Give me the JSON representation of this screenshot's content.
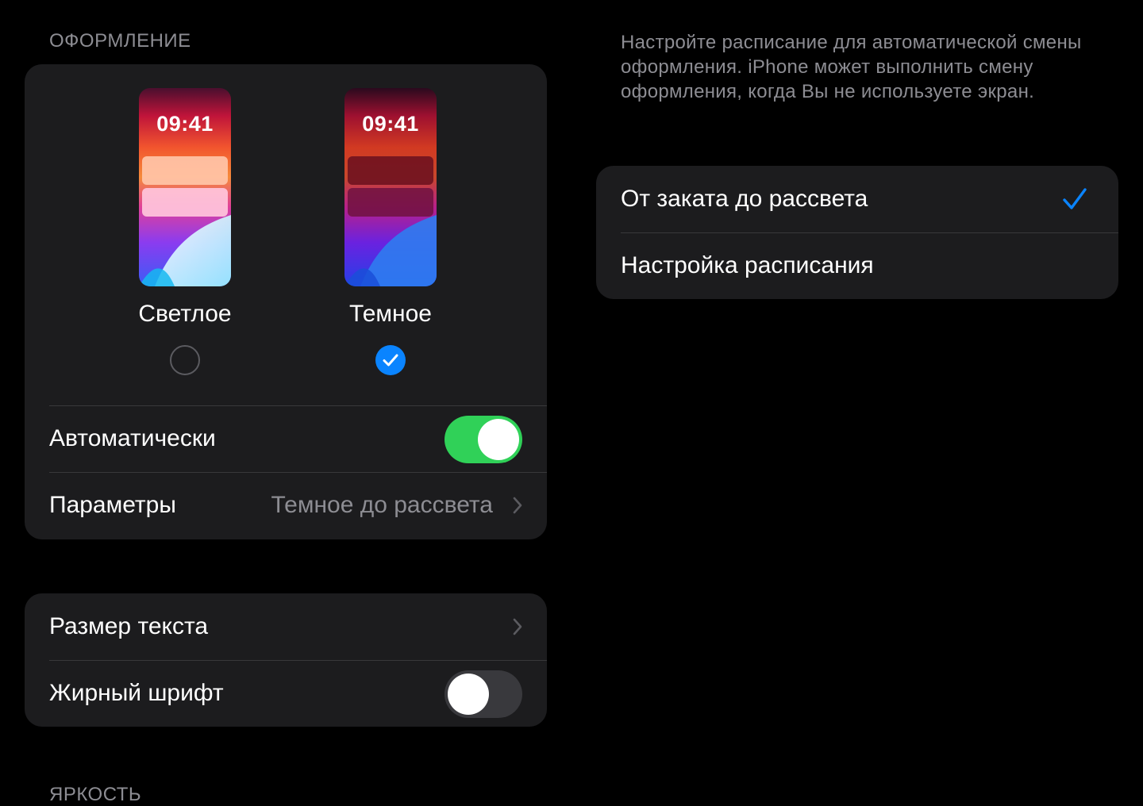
{
  "appearance": {
    "section_title": "ОФОРМЛЕНИЕ",
    "preview_time": "09:41",
    "options": [
      {
        "label": "Светлое",
        "selected": false
      },
      {
        "label": "Темное",
        "selected": true
      }
    ],
    "automatic": {
      "label": "Автоматически",
      "enabled": true
    },
    "parameters": {
      "label": "Параметры",
      "value": "Темное до рассвета"
    }
  },
  "text_settings": {
    "text_size": {
      "label": "Размер текста"
    },
    "bold_text": {
      "label": "Жирный шрифт",
      "enabled": false
    }
  },
  "next_section_title": "ЯРКОСТЬ",
  "schedule": {
    "description": "Настройте расписание для автоматической смены оформления. iPhone может выполнить смену оформления, когда Вы не используете экран.",
    "options": [
      {
        "label": "От заката до рассвета",
        "selected": true
      },
      {
        "label": "Настройка расписания",
        "selected": false
      }
    ]
  },
  "colors": {
    "background": "#000000",
    "card": "#1c1c1e",
    "separator": "#38383a",
    "secondary_text": "#8d8d93",
    "accent_blue": "#0a84ff",
    "toggle_on": "#30d158",
    "toggle_off": "#39393d"
  },
  "icons": [
    "checkmark-icon",
    "chevron-right-icon",
    "radio-checked-icon",
    "radio-unchecked-icon"
  ]
}
